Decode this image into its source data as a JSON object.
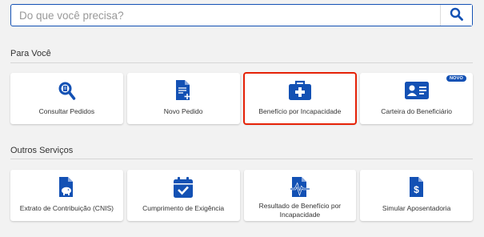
{
  "search": {
    "placeholder": "Do que você precisa?",
    "icon": "search-icon"
  },
  "accent_color": "#1351b4",
  "highlight_color": "#e52207",
  "sections": [
    {
      "title": "Para Você",
      "cards": [
        {
          "label": "Consultar Pedidos",
          "icon": "search-document-icon"
        },
        {
          "label": "Novo Pedido",
          "icon": "new-document-icon"
        },
        {
          "label": "Benefício por Incapacidade",
          "icon": "medical-kit-icon",
          "highlighted": true
        },
        {
          "label": "Carteira do Beneficiário",
          "icon": "id-card-icon",
          "badge": "NOVO"
        }
      ]
    },
    {
      "title": "Outros Serviços",
      "cards": [
        {
          "label": "Extrato de Contribuição (CNIS)",
          "icon": "piggy-bank-document-icon"
        },
        {
          "label": "Cumprimento de Exigência",
          "icon": "calendar-check-icon"
        },
        {
          "label": "Resultado de Benefício por Incapacidade",
          "icon": "heartbeat-document-icon"
        },
        {
          "label": "Simular Aposentadoria",
          "icon": "money-document-icon"
        }
      ]
    }
  ]
}
